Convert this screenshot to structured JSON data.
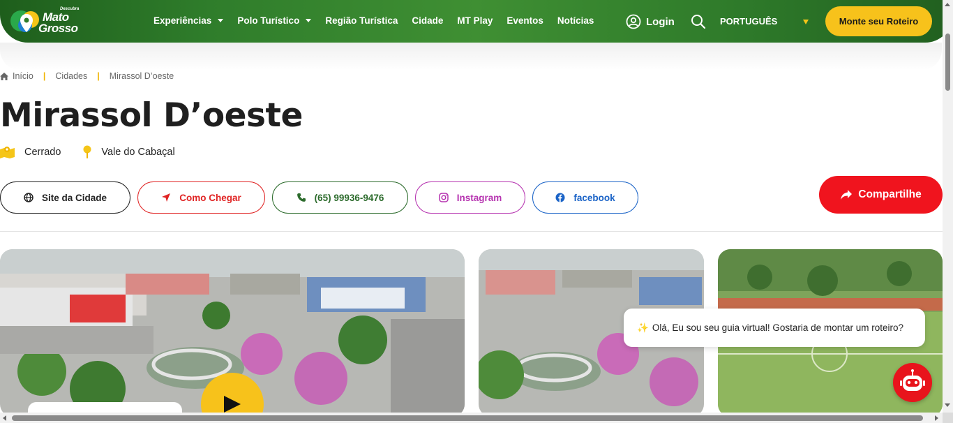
{
  "header": {
    "logo": {
      "small": "Descubra",
      "line1": "Mato",
      "line2": "Grosso"
    },
    "nav": [
      {
        "label": "Experiências",
        "has_dropdown": true
      },
      {
        "label": "Polo Turístico",
        "has_dropdown": true
      },
      {
        "label": "Região Turística",
        "has_dropdown": false
      },
      {
        "label": "Cidade",
        "has_dropdown": false
      },
      {
        "label": "MT Play",
        "has_dropdown": false
      },
      {
        "label": "Eventos",
        "has_dropdown": false
      },
      {
        "label": "Notícias",
        "has_dropdown": false
      }
    ],
    "login_label": "Login",
    "language": "PORTUGUÊS",
    "cta_label": "Monte seu Roteiro"
  },
  "breadcrumb": [
    "Início",
    "Cidades",
    "Mirassol D’oeste"
  ],
  "page": {
    "title": "Mirassol D’oeste",
    "tags": [
      {
        "icon": "map-icon",
        "label": "Cerrado"
      },
      {
        "icon": "map-pin-icon",
        "label": "Vale do Cabaçal"
      }
    ]
  },
  "actions": {
    "site": "Site da Cidade",
    "directions": "Como Chegar",
    "phone": "(65) 99936-9476",
    "instagram": "Instagram",
    "facebook": "facebook",
    "share": "Compartilhe"
  },
  "chat": {
    "message": "Olá, Eu sou seu guia virtual! Gostaria de montar um roteiro?"
  },
  "colors": {
    "header_green": "#2f7d2b",
    "accent_yellow": "#f7c21b",
    "share_red": "#f0141e",
    "directions_red": "#e02424",
    "phone_green": "#2c6b2c",
    "instagram_purple": "#b634b0",
    "facebook_blue": "#1a63c7"
  }
}
